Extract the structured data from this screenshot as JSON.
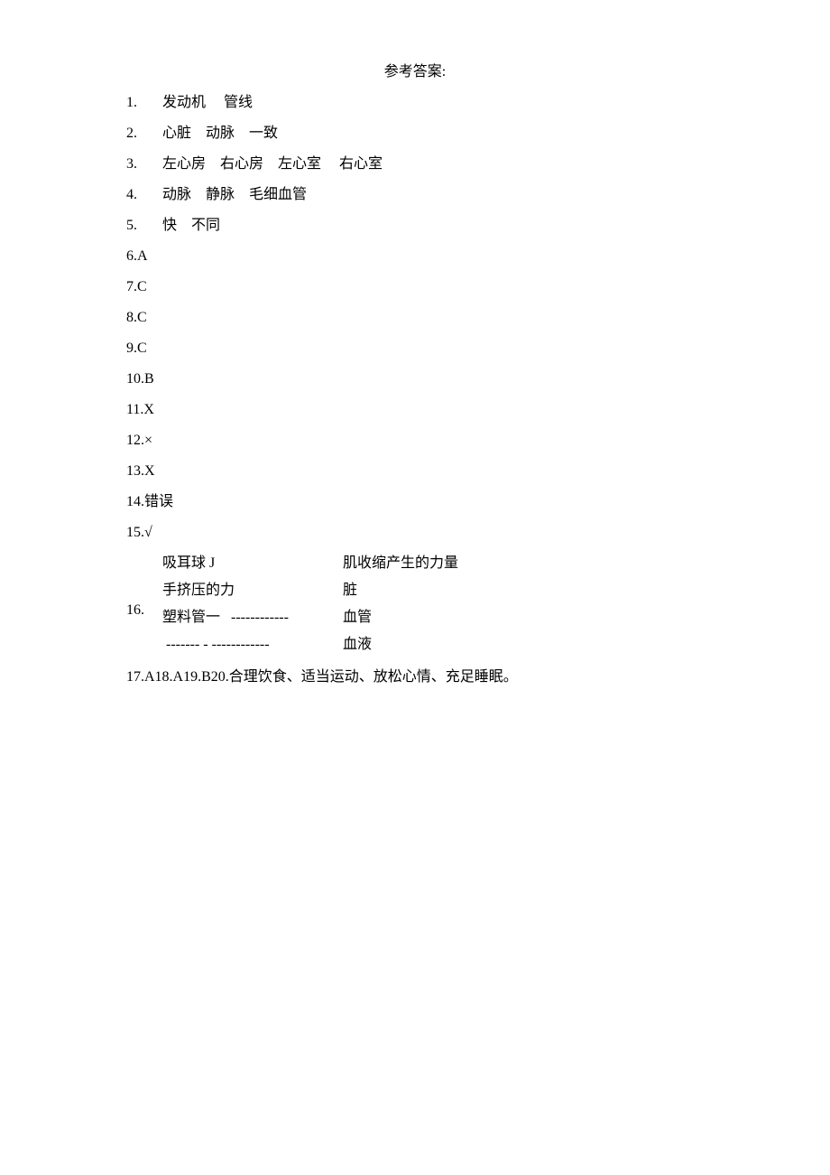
{
  "title": "参考答案:",
  "answers": {
    "q1": {
      "num": "1.",
      "vals": [
        "发动机",
        "管线"
      ]
    },
    "q2": {
      "num": "2.",
      "vals": [
        "心脏",
        "动脉",
        "一致"
      ]
    },
    "q3": {
      "num": "3.",
      "vals": [
        "左心房",
        "右心房",
        "左心室",
        "右心室"
      ]
    },
    "q4": {
      "num": "4.",
      "vals": [
        "动脉",
        "静脉",
        "毛细血管"
      ]
    },
    "q5": {
      "num": "5.",
      "vals": [
        "快",
        "不同"
      ]
    },
    "q6": {
      "text": "6.A"
    },
    "q7": {
      "text": "7.C"
    },
    "q8": {
      "text": "8.C"
    },
    "q9": {
      "text": "9.C"
    },
    "q10": {
      "text": "10.B"
    },
    "q11": {
      "text": "11.X"
    },
    "q12": {
      "text": "12.×"
    },
    "q13": {
      "text": "13.X"
    },
    "q14": {
      "text": "14.错误"
    },
    "q15": {
      "text": "15.√"
    },
    "q16": {
      "num": "16.",
      "rows": [
        {
          "left": "吸耳球 J",
          "right": "肌收缩产生的力量"
        },
        {
          "left": "手挤压的力",
          "right": "脏"
        },
        {
          "left": "塑料管一   ------------",
          "right": "血管"
        },
        {
          "left": " ------- - ------------",
          "right": "血液"
        }
      ]
    },
    "q17": {
      "text": "17.A18.A19.B20.合理饮食、适当运动、放松心情、充足睡眠。"
    }
  }
}
